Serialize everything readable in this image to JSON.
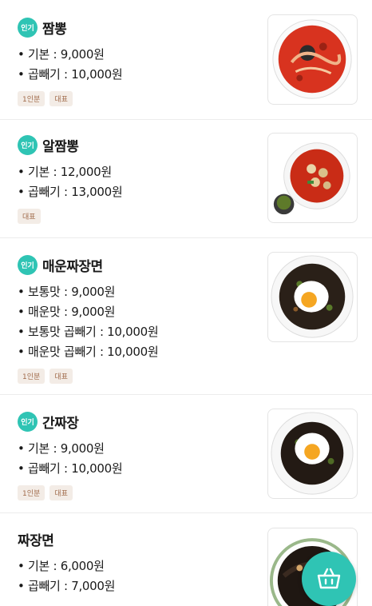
{
  "colors": {
    "accent": "#2fc4b4",
    "tag_bg": "#f3ece6",
    "tag_text": "#a06a4a"
  },
  "popular_badge": "인기",
  "menu": [
    {
      "name": "짬뽕",
      "popular": true,
      "prices": [
        "• 기본 : 9,000원",
        "• 곱빼기 : 10,000원"
      ],
      "tags": [
        "1인분",
        "대표"
      ],
      "image": "jjamppong-icon"
    },
    {
      "name": "알짬뽕",
      "popular": true,
      "prices": [
        "• 기본 : 12,000원",
        "• 곱빼기 : 13,000원"
      ],
      "tags": [
        "대표"
      ],
      "image": "al-jjamppong-icon"
    },
    {
      "name": "매운짜장면",
      "popular": true,
      "prices": [
        "• 보통맛 : 9,000원",
        "• 매운맛 : 9,000원",
        "• 보통맛 곱빼기 : 10,000원",
        "• 매운맛 곱빼기 : 10,000원"
      ],
      "tags": [
        "1인분",
        "대표"
      ],
      "image": "spicy-jjajangmyeon-icon"
    },
    {
      "name": "간짜장",
      "popular": true,
      "prices": [
        "• 기본 : 9,000원",
        "• 곱빼기 : 10,000원"
      ],
      "tags": [
        "1인분",
        "대표"
      ],
      "image": "ganjjajang-icon"
    },
    {
      "name": "짜장면",
      "popular": false,
      "prices": [
        "• 기본 : 6,000원",
        "• 곱빼기 : 7,000원"
      ],
      "tags": [],
      "image": "jjajangmyeon-icon"
    }
  ],
  "cart_button": {
    "icon": "basket-icon"
  }
}
